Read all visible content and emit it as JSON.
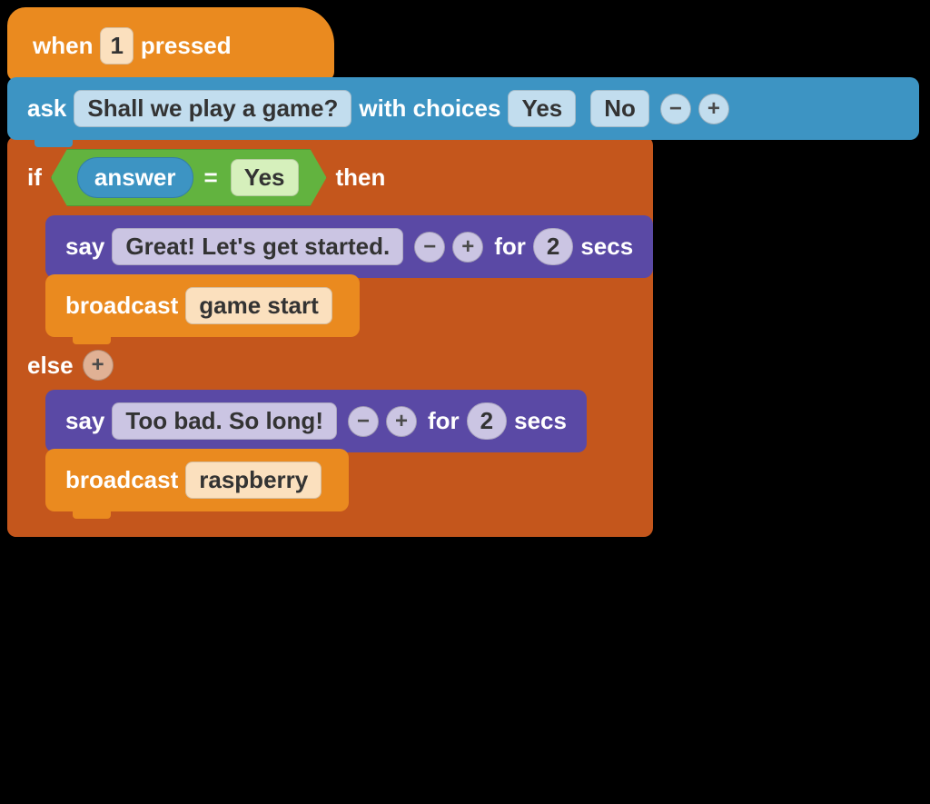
{
  "blocks": {
    "hat": {
      "prefix": "when",
      "key": "1",
      "suffix": "pressed"
    },
    "ask": {
      "label_ask": "ask",
      "question": "Shall we play a game?",
      "label_with": "with choices",
      "choices": [
        "Yes",
        "No"
      ],
      "minus": "−",
      "plus": "+"
    },
    "if": {
      "label_if": "if",
      "reporter": "answer",
      "op": "=",
      "compare_value": "Yes",
      "label_then": "then",
      "label_else": "else",
      "else_plus": "+"
    },
    "say1": {
      "label_say": "say",
      "text": "Great! Let's get started.",
      "minus": "−",
      "plus": "+",
      "label_for": "for",
      "secs_value": "2",
      "label_secs": "secs"
    },
    "broadcast1": {
      "label": "broadcast",
      "message": "game start"
    },
    "say2": {
      "label_say": "say",
      "text": "Too bad. So long!",
      "minus": "−",
      "plus": "+",
      "label_for": "for",
      "secs_value": "2",
      "label_secs": "secs"
    },
    "broadcast2": {
      "label": "broadcast",
      "message": "raspberry"
    }
  }
}
